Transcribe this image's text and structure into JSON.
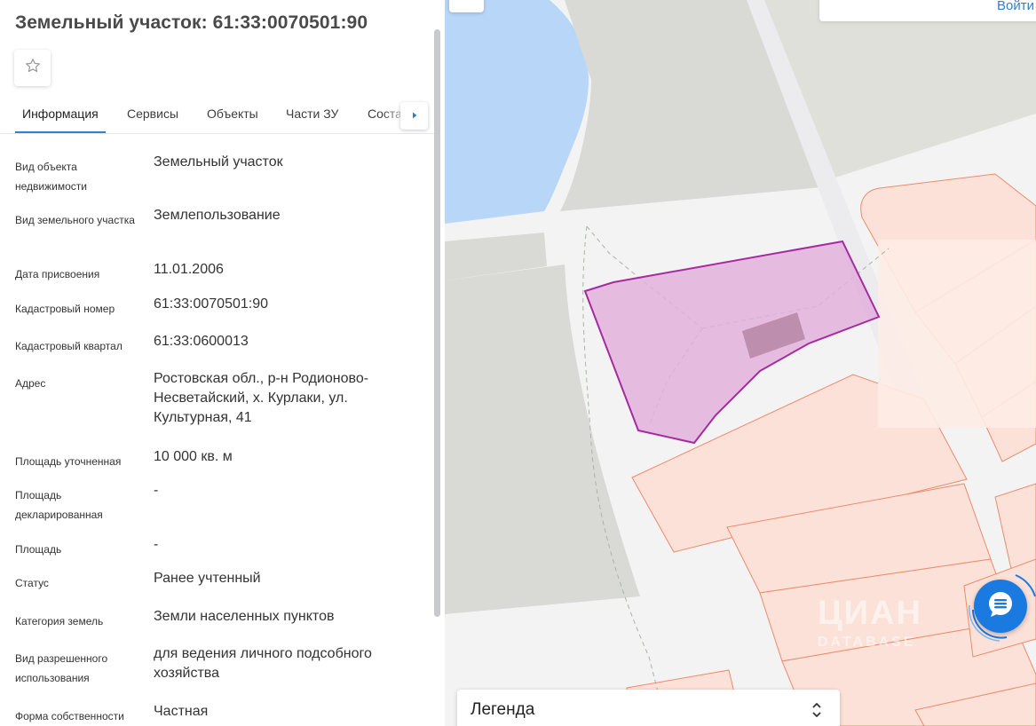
{
  "page": {
    "title": "Земельный участок: 61:33:0070501:90"
  },
  "favorite": {
    "icon": "star-outline-icon"
  },
  "tabs": [
    {
      "label": "Информация",
      "active": true
    },
    {
      "label": "Сервисы",
      "active": false
    },
    {
      "label": "Объекты",
      "active": false
    },
    {
      "label": "Части ЗУ",
      "active": false
    },
    {
      "label": "Состав ЗУ",
      "active": false
    }
  ],
  "tabs_next_icon": "caret-right-icon",
  "properties": [
    {
      "label": "Вид объекта недвижимости",
      "value": "Земельный участок"
    },
    {
      "label": "Вид земельного участка",
      "value": "Землепользование"
    },
    {
      "label": "Дата присвоения",
      "value": "11.01.2006"
    },
    {
      "label": "Кадастровый номер",
      "value": "61:33:0070501:90"
    },
    {
      "label": "Кадастровый квартал",
      "value": "61:33:0600013"
    },
    {
      "label": "Адрес",
      "value": "Ростовская обл., р-н Родионово-Несветайский, х. Курлаки, ул. Культурная, 41"
    },
    {
      "label": "Площадь уточненная",
      "value": "10 000 кв. м"
    },
    {
      "label": "Площадь декларированная",
      "value": "-"
    },
    {
      "label": "Площадь",
      "value": "-"
    },
    {
      "label": "Статус",
      "value": "Ранее учтенный"
    },
    {
      "label": "Категория земель",
      "value": "Земли населенных пунктов"
    },
    {
      "label": "Вид разрешенного использования",
      "value": "для ведения личного подсобного хозяйства"
    },
    {
      "label": "Форма собственности",
      "value": "Частная"
    }
  ],
  "map": {
    "login_label": "Войти",
    "watermark": "ЦИАН",
    "watermark_sub": "DATABASE",
    "legend_label": "Легенда",
    "chat_icon": "chat-bubble-icon",
    "colors": {
      "water": "#b8d6f8",
      "green_area": "#d9dad6",
      "parcel_fill": "#fbe1d7",
      "parcel_stroke": "#ec8b6c",
      "selected_fill": "#e2b0dc",
      "selected_stroke": "#a52ba0",
      "building": "#bd8eae",
      "accent": "#1a7ae0"
    }
  }
}
